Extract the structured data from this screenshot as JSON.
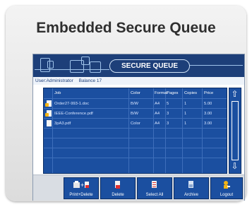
{
  "card": {
    "title": "Embedded Secure Queue"
  },
  "banner": {
    "title": "SECURE QUEUE"
  },
  "userbar": {
    "user": "User:Administrator",
    "balance": "Balance 17"
  },
  "table": {
    "headers": [
      "Job",
      "Color",
      "Format",
      "Pages",
      "Copies",
      "Price"
    ],
    "rows": [
      {
        "job": "Order27-993-1.doc",
        "color": "B/W",
        "format": "A4",
        "pages": "5",
        "copies": "1",
        "price": "5.00",
        "locked": true
      },
      {
        "job": "IEEE-Conference.pdf",
        "color": "B/W",
        "format": "A4",
        "pages": "3",
        "copies": "1",
        "price": "3.00",
        "locked": true
      },
      {
        "job": "3pA3.pdf",
        "color": "Color",
        "format": "A4",
        "pages": "3",
        "copies": "1",
        "price": "3.00",
        "locked": false
      }
    ]
  },
  "scrollbar": {
    "up_icon": "arrow-up-icon",
    "down_icon": "arrow-down-icon"
  },
  "toolbar": {
    "print_delete": "Print+Delete",
    "delete": "Delete",
    "select_all": "Select All",
    "archive": "Archive",
    "logout": "Logout"
  },
  "colors": {
    "banner": "#1d3f79",
    "panel": "#1b4fa0",
    "accent": "#9fc3ea"
  }
}
